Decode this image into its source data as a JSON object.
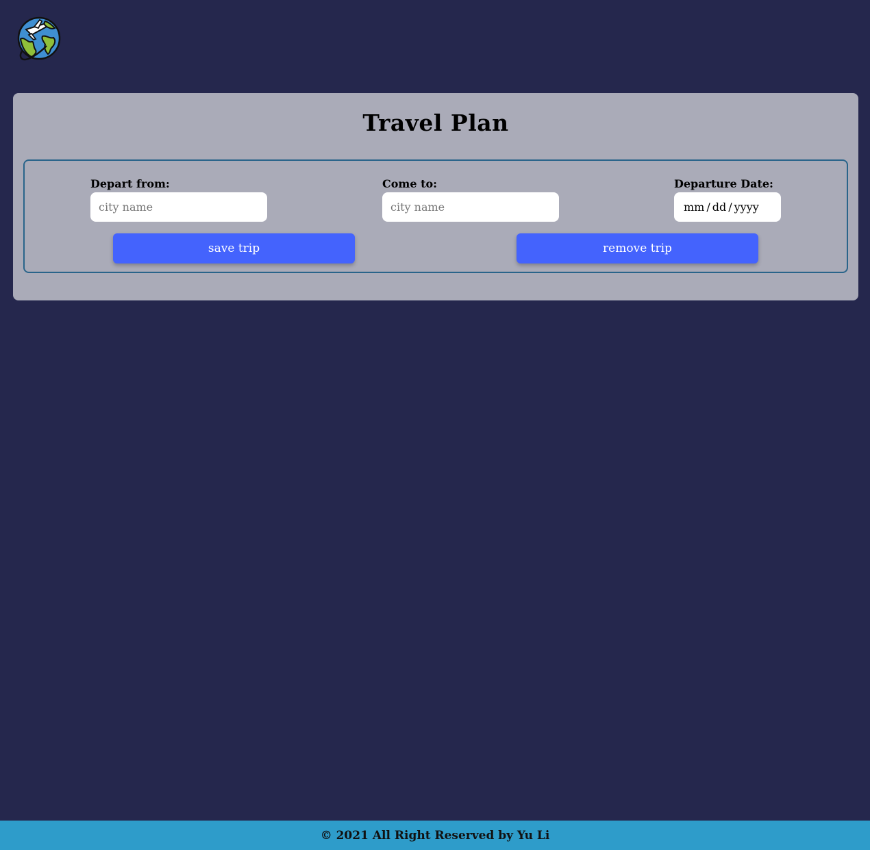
{
  "header": {
    "logo_icon": "globe-airplane-icon"
  },
  "main": {
    "title": "Travel Plan",
    "form": {
      "depart": {
        "label": "Depart from:",
        "placeholder": "city name",
        "value": ""
      },
      "arrive": {
        "label": "Come to:",
        "placeholder": "city name",
        "value": ""
      },
      "date": {
        "label": "Departure Date:",
        "mm": "mm",
        "dd": "dd",
        "yyyy": "yyyy",
        "sep": "/"
      },
      "save_label": "save trip",
      "remove_label": "remove trip"
    }
  },
  "footer": {
    "text": "© 2021 All Right Reserved by Yu Li"
  },
  "colors": {
    "background": "#25274d",
    "panel": "#aaabb8",
    "form_border": "#29648a",
    "button": "#4463fd",
    "footer": "#2e9cca"
  }
}
